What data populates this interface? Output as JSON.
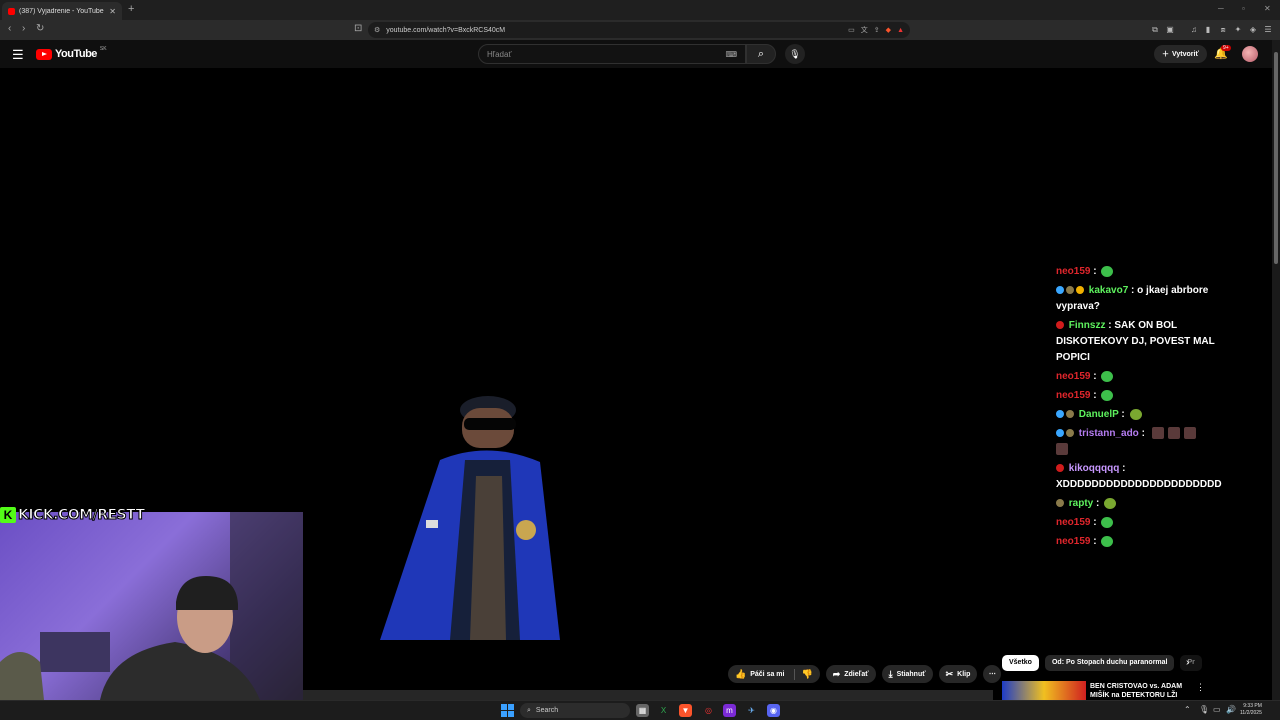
{
  "browser": {
    "tab_title": "(387) Vyjadrenie - YouTube",
    "url": "youtube.com/watch?v=BxckRCS40cM",
    "new_tab_icon": "plus-icon"
  },
  "youtube": {
    "logo_text": "YouTube",
    "country_code": "SK",
    "search_placeholder": "Hľadať",
    "create_label": "Vytvoriť",
    "notif_count": "9+"
  },
  "overlay": {
    "kick_logo": "K",
    "kick_text": "KICK.COM/RESTT"
  },
  "chat": [
    {
      "user": "neo159",
      "color": "#e0262c",
      "message": "",
      "emote": "green"
    },
    {
      "user": "kakavo7",
      "color": "#5ef25e",
      "message": "o jkaej abrbore vyprava?",
      "badges": [
        "cube",
        "moon",
        "coin"
      ]
    },
    {
      "user": "Finnszz",
      "color": "#5ef25e",
      "message": "SAK ON BOL DISKOTEKOVY DJ, POVEST MAL POPICI",
      "badges": [
        "red"
      ]
    },
    {
      "user": "neo159",
      "color": "#e0262c",
      "message": "",
      "emote": "green"
    },
    {
      "user": "neo159",
      "color": "#e0262c",
      "message": "",
      "emote": "green"
    },
    {
      "user": "DanuelP",
      "color": "#5ef25e",
      "message": "",
      "emote": "orb",
      "badges": [
        "cube",
        "moon"
      ]
    },
    {
      "user": "tristann_ado",
      "color": "#b47cf0",
      "message": "",
      "emote": "faces",
      "badges": [
        "cube",
        "moon"
      ]
    },
    {
      "user": "kikoqqqqq",
      "color": "#c898ff",
      "message": "XDDDDDDDDDDDDDDDDDDDDDD",
      "badges": [
        "red"
      ]
    },
    {
      "user": "rapty",
      "color": "#5ef25e",
      "message": "",
      "emote": "orb",
      "badges": [
        "moon"
      ]
    },
    {
      "user": "neo159",
      "color": "#e0262c",
      "message": "",
      "emote": "green"
    },
    {
      "user": "neo159",
      "color": "#e0262c",
      "message": "",
      "emote": "green"
    }
  ],
  "actions": {
    "like_label": "Páči sa mi",
    "share_label": "Zdieľať",
    "download_label": "Stiahnuť",
    "clip_label": "Klip"
  },
  "chips": {
    "all": "Všetko",
    "from": "Od: Po Stopach duchu paranormal",
    "partial": "Pr"
  },
  "recommendation": {
    "title": "BEN CRISTOVAO vs. ADAM MIŠÍK na DETEKTORU LŽI"
  },
  "taskbar": {
    "search_label": "Search",
    "time": "9:33 PM",
    "date": "11/2/2025"
  }
}
